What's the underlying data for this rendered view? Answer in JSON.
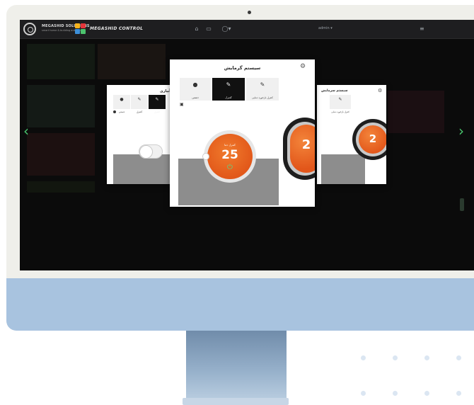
{
  "brand": {
    "name": "MEGASHID CONTROL",
    "small_name": "MEGASHID SOLUTIONS",
    "tagline": "smart home & building automation",
    "logo_colors": [
      "#f6b21c",
      "#e2353a",
      "#3c8fd8",
      "#4cc36d"
    ]
  },
  "topbar": {
    "user": "admin ▾",
    "icons": [
      "home-icon",
      "monitor-icon",
      "gauge-icon",
      "menu-icon"
    ]
  },
  "nav": {
    "prev": "‹",
    "next": "›"
  },
  "panel_left": {
    "title": "آبیاری",
    "tabs": [
      {
        "label": "دستی",
        "icon": "hand-icon"
      },
      {
        "label": "کنترل",
        "icon": "pencil-icon"
      },
      {
        "label": "کنترل",
        "icon": "pencil-icon",
        "active": true
      }
    ]
  },
  "panel_center": {
    "title": "سیستم گرمایش",
    "tabs": [
      {
        "label": "دستی",
        "icon": "hand-icon"
      },
      {
        "label": "کنترل",
        "icon": "pencil-icon",
        "active": true
      },
      {
        "label": "کنترل بازخورد دمایی",
        "icon": "edit-icon"
      }
    ],
    "dial": {
      "label": "کنترل دما",
      "value": "25"
    },
    "nest_value": "2"
  },
  "panel_right": {
    "title": "سیستم سرمایش",
    "tabs": [
      {
        "label": "کنترل بازخورد دمایی",
        "icon": "edit-icon"
      }
    ],
    "nest_value": "2"
  },
  "colors": {
    "accent": "#e2581a",
    "green": "#49c66e",
    "chin": "#a8c3df"
  }
}
